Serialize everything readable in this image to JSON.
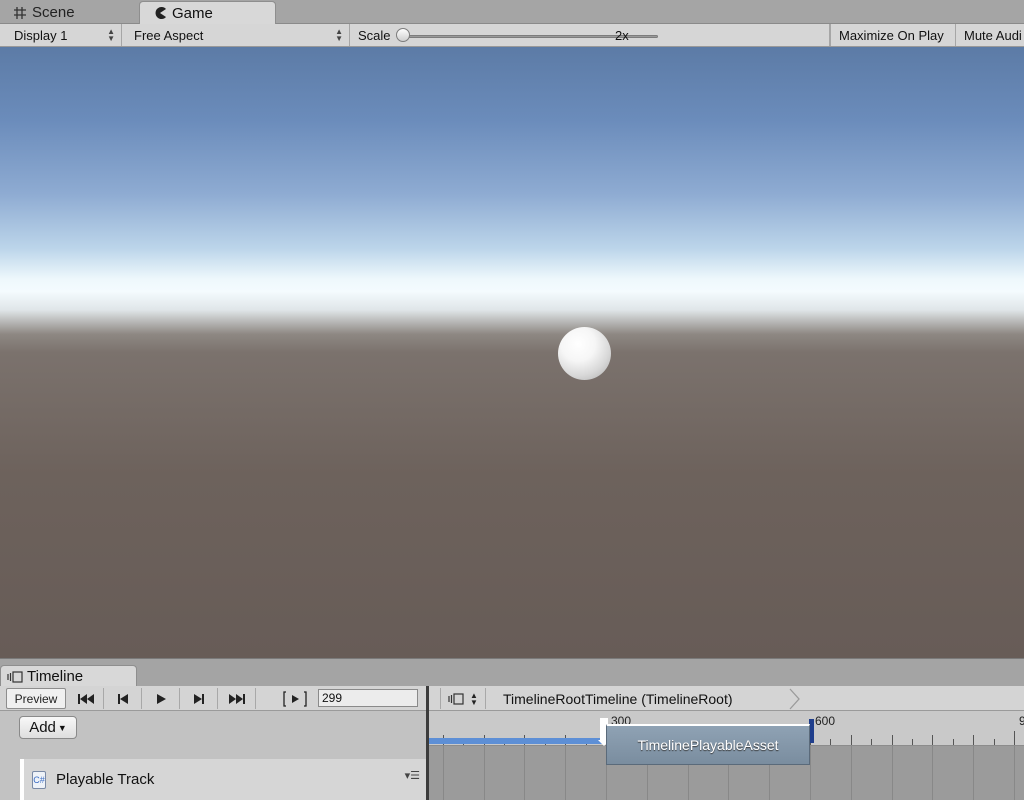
{
  "tabs": {
    "scene_label": "Scene",
    "game_label": "Game"
  },
  "game_toolbar": {
    "display": "Display 1",
    "aspect": "Free Aspect",
    "scale_label": "Scale",
    "scale_value": "2x",
    "maximize_on_play": "Maximize On Play",
    "mute_audio": "Mute Audi"
  },
  "timeline": {
    "tab_label": "Timeline",
    "preview_label": "Preview",
    "frame": "299",
    "breadcrumb": "TimelineRootTimeline (TimelineRoot)",
    "add_label": "Add",
    "ruler": {
      "mark_300": "300",
      "mark_600": "600",
      "mark_9": "9"
    },
    "track": {
      "name": "Playable Track"
    },
    "clip": {
      "name": "TimelinePlayableAsset"
    }
  },
  "colors": {
    "play_range": "#5d8fd6",
    "end_marker": "#1f3e8c",
    "clip": "#8597aa"
  }
}
